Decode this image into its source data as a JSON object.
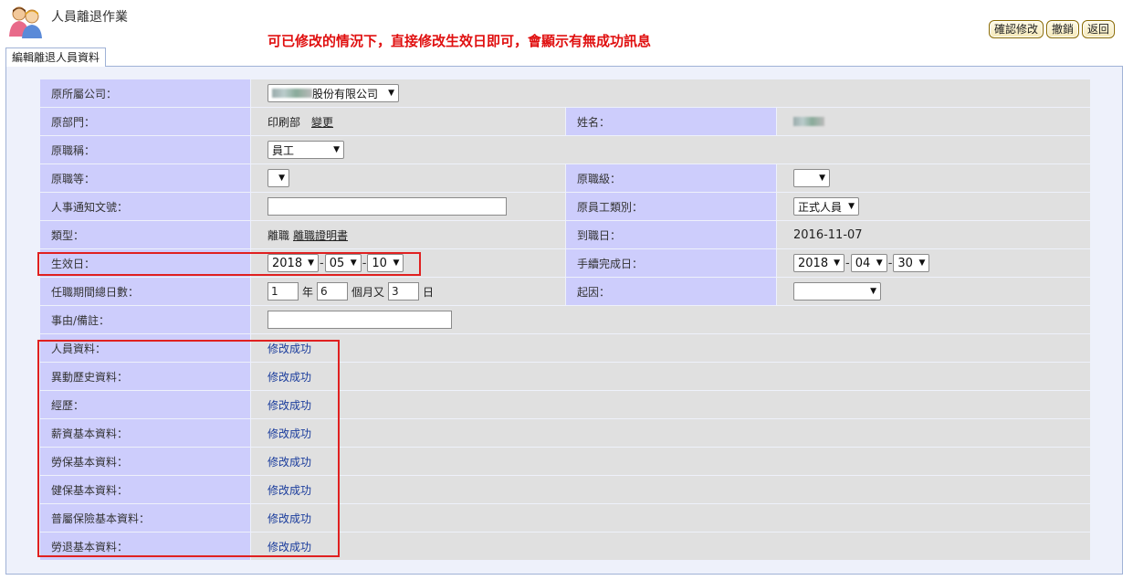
{
  "header": {
    "title": "人員離退作業",
    "banner": "可已修改的情況下，直接修改生效日即可，會顯示有無成功訊息",
    "buttons": {
      "confirm": "確認修改",
      "cancel": "撤銷",
      "back": "返回"
    }
  },
  "tab": {
    "label": "編輯離退人員資料"
  },
  "form": {
    "company": {
      "label": "原所屬公司：",
      "value": "股份有限公司"
    },
    "dept": {
      "label": "原部門：",
      "value": "印刷部",
      "link": "變更"
    },
    "name": {
      "label": "姓名："
    },
    "jobtitle": {
      "label": "原職稱：",
      "value": "員工"
    },
    "grade": {
      "label": "原職等："
    },
    "level": {
      "label": "原職級："
    },
    "notice": {
      "label": "人事通知文號：",
      "value": ""
    },
    "emptype": {
      "label": "原員工類別：",
      "value": "正式人員"
    },
    "type": {
      "label": "類型：",
      "value": "離職",
      "link": "離職證明書"
    },
    "arrive": {
      "label": "到職日：",
      "value": "2016-11-07"
    },
    "effective": {
      "label": "生效日：",
      "year": "2018",
      "month": "05",
      "day": "10"
    },
    "complete": {
      "label": "手續完成日：",
      "year": "2018",
      "month": "04",
      "day": "30"
    },
    "tenure": {
      "label": "任職期間總日數：",
      "years": "1",
      "year_unit": "年",
      "months": "6",
      "month_unit": "個月又",
      "days": "3",
      "day_unit": "日"
    },
    "cause": {
      "label": "起因：",
      "value": ""
    },
    "remark": {
      "label": "事由/備註：",
      "value": ""
    }
  },
  "results": [
    {
      "label": "人員資料：",
      "status": "修改成功"
    },
    {
      "label": "異動歷史資料：",
      "status": "修改成功"
    },
    {
      "label": "經歷：",
      "status": "修改成功"
    },
    {
      "label": "薪資基本資料：",
      "status": "修改成功"
    },
    {
      "label": "勞保基本資料：",
      "status": "修改成功"
    },
    {
      "label": "健保基本資料：",
      "status": "修改成功"
    },
    {
      "label": "普屬保險基本資料：",
      "status": "修改成功"
    },
    {
      "label": "勞退基本資料：",
      "status": "修改成功"
    }
  ],
  "icons": {
    "app": "people-icon",
    "dropdown": "chevron-down-icon"
  },
  "colors": {
    "label_bg": "#cdcdfc",
    "value_bg": "#e0e0e0",
    "highlight": "#e02020",
    "banner": "#e01010"
  }
}
